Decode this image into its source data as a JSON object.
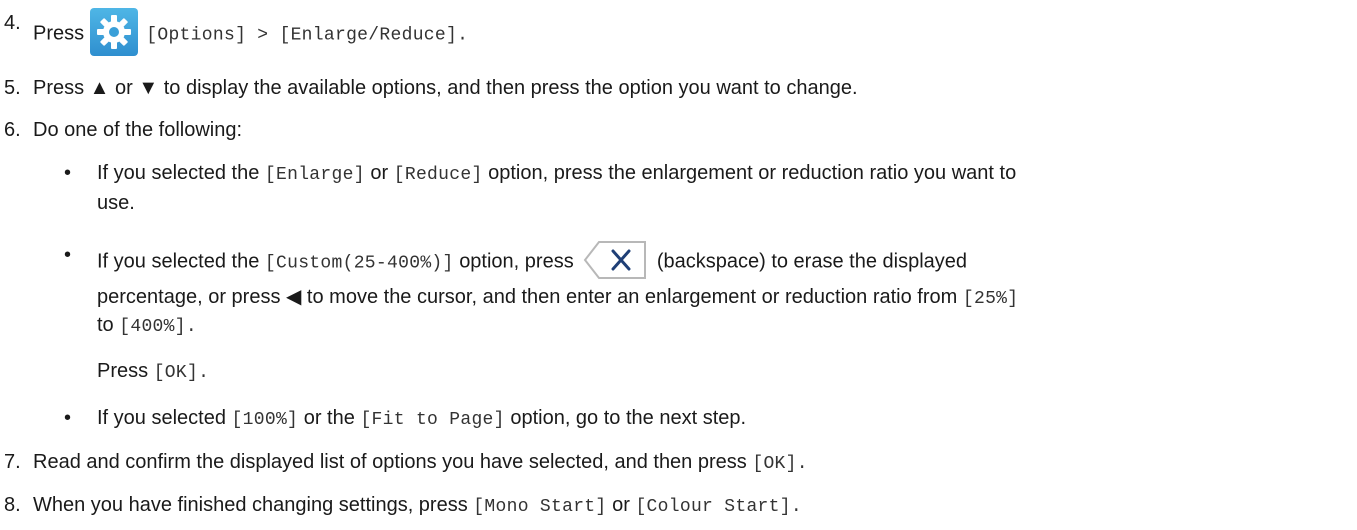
{
  "steps": {
    "s4": {
      "num": "4.",
      "t1": "Press",
      "m1": "[Options] > [Enlarge/Reduce].",
      "icon": "gear-icon"
    },
    "s5": {
      "num": "5.",
      "t1": "Press ▲ or ▼ to display the available options, and then press the option you want to change."
    },
    "s6": {
      "num": "6.",
      "t1": "Do one of the following:",
      "b1": {
        "bullet": "•",
        "t1": "If you selected the",
        "m1": "[Enlarge]",
        "t2": "or",
        "m2": "[Reduce]",
        "t3": "option, press the enlargement or reduction ratio you want to",
        "t4": "use."
      },
      "b2": {
        "bullet": "•",
        "t1": "If you selected the",
        "m1": "[Custom(25-400%)]",
        "t2": "option, press",
        "icon": "backspace-icon",
        "t3": "(backspace) to erase the displayed",
        "t4": "percentage, or press ◀ to move the cursor, and then enter an enlargement or reduction ratio from",
        "m2": "[25%]",
        "t5": "to",
        "m3": "[400%].",
        "t6": "Press",
        "m4": "[OK]."
      },
      "b3": {
        "bullet": "•",
        "t1": "If you selected",
        "m1": "[100%]",
        "t2": "or the",
        "m2": "[Fit to Page]",
        "t3": "option, go to the next step."
      }
    },
    "s7": {
      "num": "7.",
      "t1": "Read and confirm the displayed list of options you have selected, and then press",
      "m1": "[OK]."
    },
    "s8": {
      "num": "8.",
      "t1": "When you have finished changing settings, press",
      "m1": "[Mono Start]",
      "t2": "or",
      "m2": "[Colour Start]."
    }
  }
}
